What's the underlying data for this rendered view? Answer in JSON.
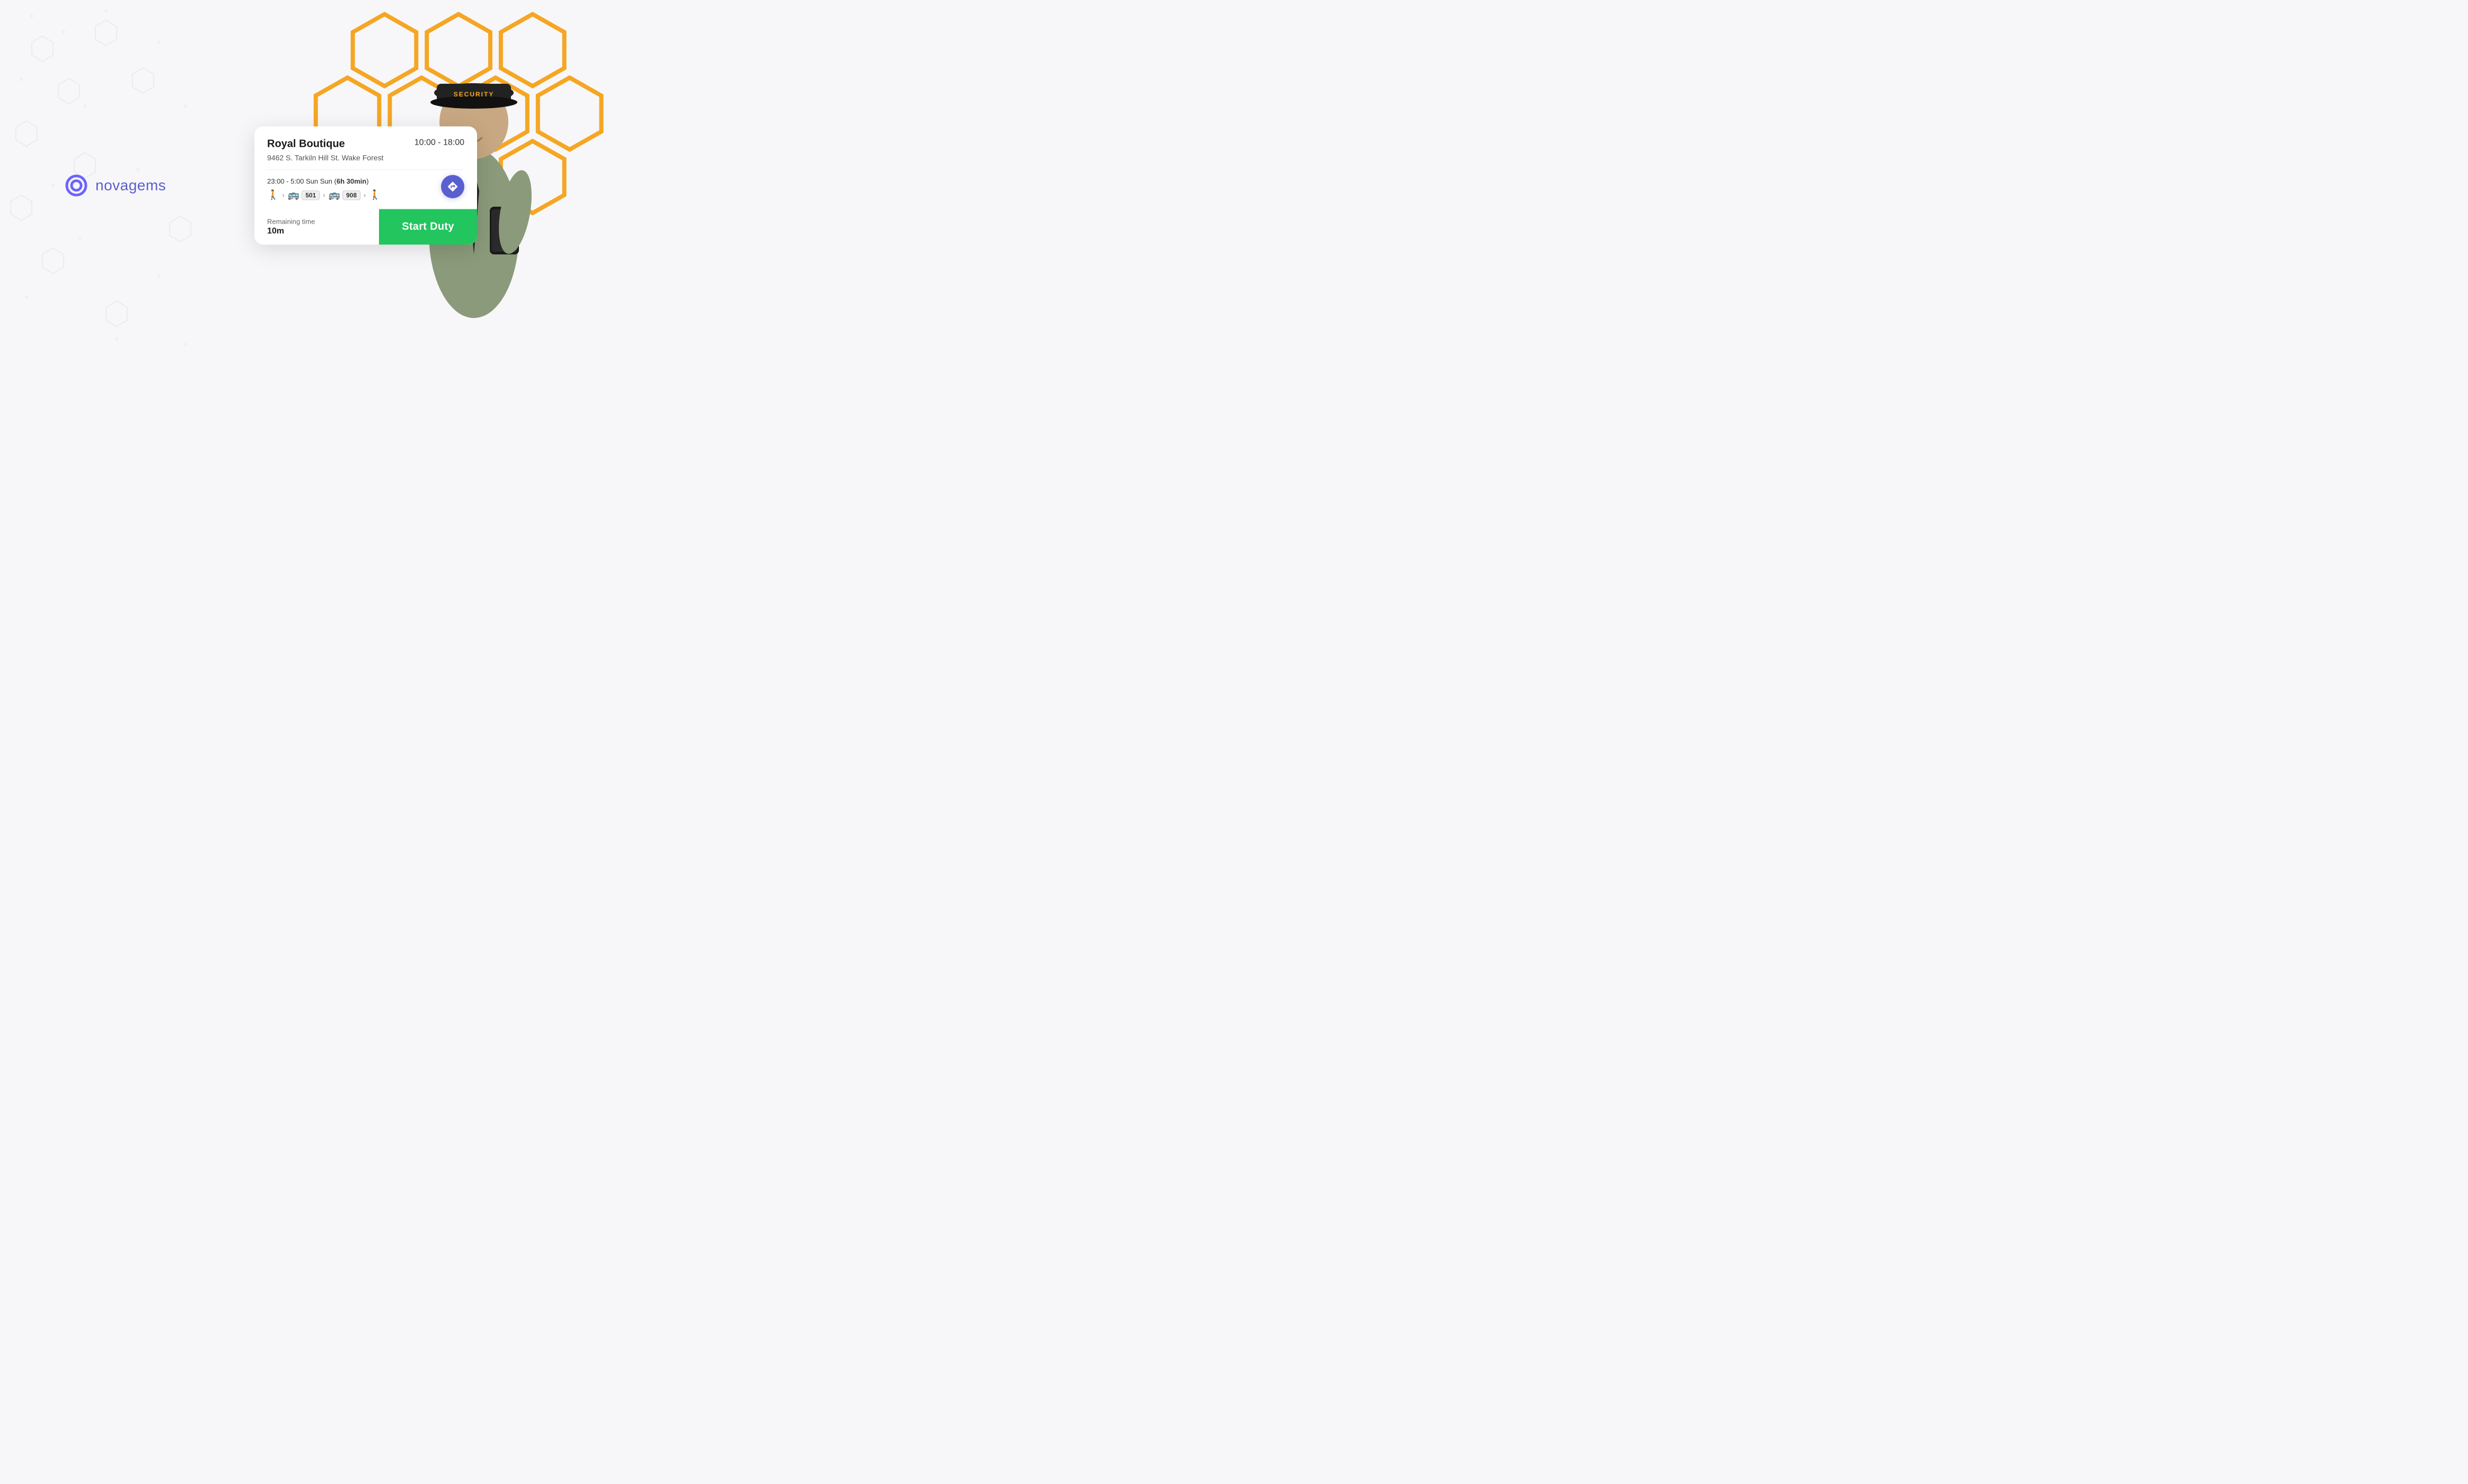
{
  "logo": {
    "text": "novagems",
    "icon_name": "ring-icon"
  },
  "card": {
    "venue_name": "Royal Boutique",
    "time_range": "10:00 - 18:00",
    "address": "9462 S. Tarkiln Hill St. Wake Forest",
    "transit_time": "23:00 - 5:00 Sun",
    "transit_duration": "6h 30min",
    "transit_route": [
      {
        "type": "walk"
      },
      {
        "type": "bus",
        "number": "501"
      },
      {
        "type": "bus",
        "number": "908"
      },
      {
        "type": "walk"
      }
    ],
    "remaining_label": "Remaining time",
    "remaining_value": "10m",
    "start_duty_label": "Start Duty",
    "route_icon": "directions-icon"
  },
  "colors": {
    "accent_purple": "#5a5fcf",
    "accent_orange": "#f5a623",
    "green": "#22c55e",
    "logo_purple": "#6c63ff"
  }
}
